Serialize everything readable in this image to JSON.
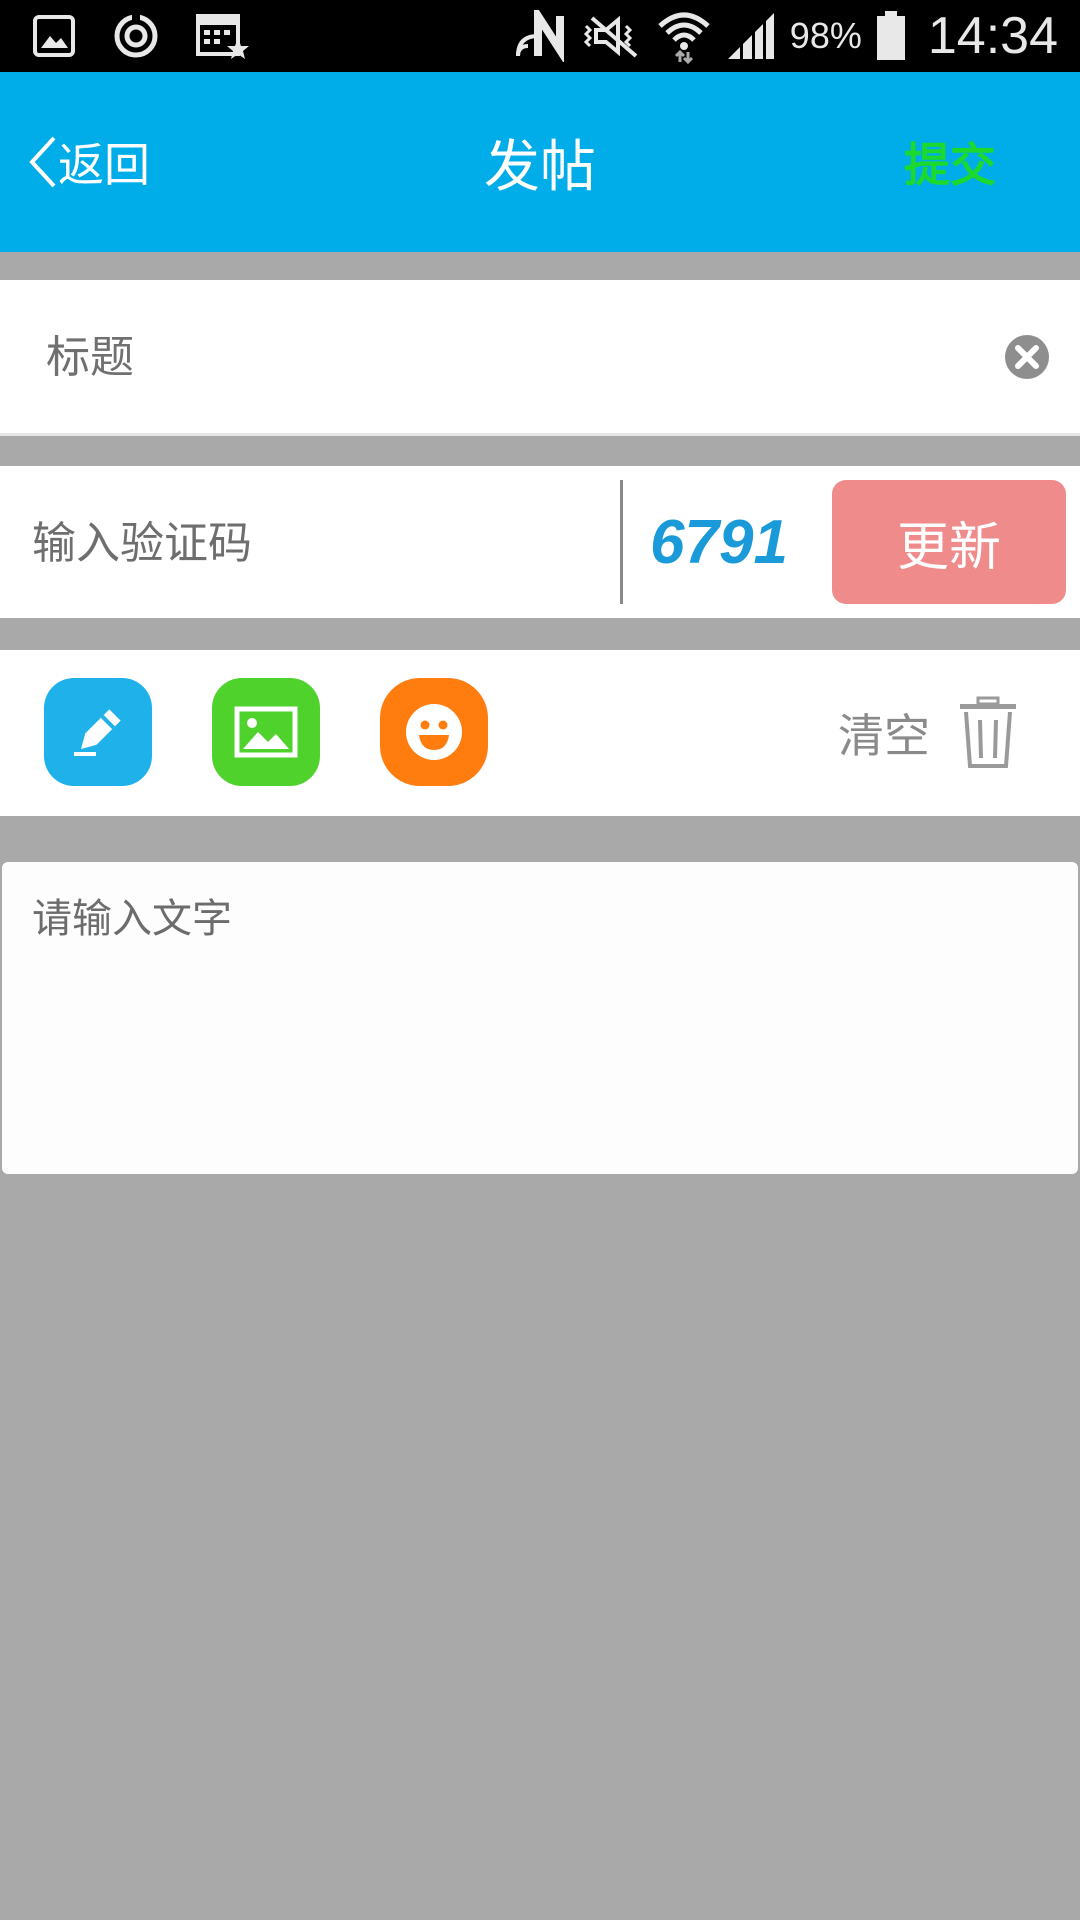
{
  "status_bar": {
    "battery_percent": "98%",
    "time": "14:34",
    "icons": [
      "gallery-icon",
      "sync-icon",
      "calendar-star-icon",
      "nfc-icon",
      "vibrate-mute-icon",
      "wifi-icon",
      "signal-icon",
      "battery-icon"
    ]
  },
  "nav": {
    "back_label": "返回",
    "title": "发帖",
    "submit_label": "提交",
    "submit_color": "#1bd92e",
    "bar_color": "#00ade8"
  },
  "title_field": {
    "placeholder": "标题",
    "value": ""
  },
  "captcha": {
    "placeholder": "输入验证码",
    "value": "",
    "code": "6791",
    "refresh_label": "更新",
    "refresh_color": "#ef8b8b"
  },
  "toolbar": {
    "tools": [
      {
        "icon": "pencil-icon",
        "color": "#1fb1ea"
      },
      {
        "icon": "image-icon",
        "color": "#4fd22c"
      },
      {
        "icon": "emoji-icon",
        "color": "#ff7c0f"
      }
    ],
    "clear_label": "清空"
  },
  "content": {
    "placeholder": "请输入文字",
    "value": ""
  }
}
